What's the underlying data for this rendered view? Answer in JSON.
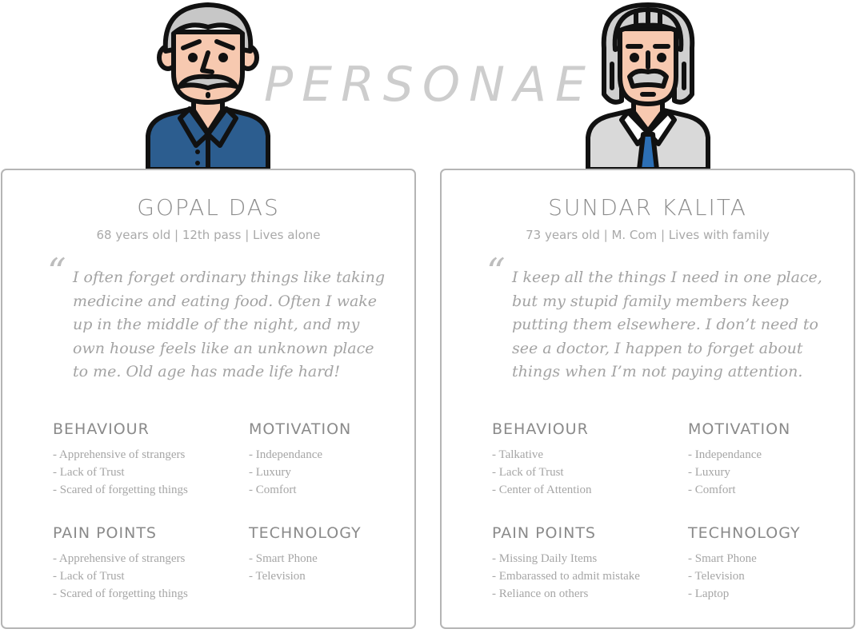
{
  "title": "PERSONAE",
  "personas": [
    {
      "name": "GOPAL DAS",
      "meta": "68 years old | 12th pass | Lives alone",
      "quote": "I often forget ordinary things like taking medicine and eating food. Often I wake up in the middle of the night, and my own house feels like an unknown place to me. Old age has made life hard!",
      "behaviour": {
        "title": "BEHAVIOUR",
        "items": [
          "- Apprehensive of strangers",
          "- Lack of Trust",
          "- Scared of forgetting things"
        ]
      },
      "motivation": {
        "title": "MOTIVATION",
        "items": [
          "- Independance",
          "- Luxury",
          "- Comfort"
        ]
      },
      "pain_points": {
        "title": "PAIN POINTS",
        "items": [
          "- Apprehensive of strangers",
          "- Lack of Trust",
          "- Scared of forgetting things"
        ]
      },
      "technology": {
        "title": "TECHNOLOGY",
        "items": [
          "- Smart Phone",
          "- Television"
        ]
      },
      "colors": {
        "shirt": "#2c5d8f",
        "hair": "#c7c7c7",
        "skin": "#f7c9b0"
      }
    },
    {
      "name": "SUNDAR KALITA",
      "meta": "73 years old | M. Com | Lives with family",
      "quote": "I keep all the things I need in one place, but my stupid family members keep putting them elsewhere. I don’t need to see a doctor, I happen to forget about things when I’m not paying attention.",
      "behaviour": {
        "title": "BEHAVIOUR",
        "items": [
          "- Talkative",
          "- Lack of Trust",
          "- Center of Attention"
        ]
      },
      "motivation": {
        "title": "MOTIVATION",
        "items": [
          "- Independance",
          "- Luxury",
          "- Comfort"
        ]
      },
      "pain_points": {
        "title": "PAIN POINTS",
        "items": [
          "- Missing Daily Items",
          "- Embarassed to admit mistake",
          "- Reliance on others"
        ]
      },
      "technology": {
        "title": "TECHNOLOGY",
        "items": [
          "- Smart Phone",
          "- Television",
          "- Laptop"
        ]
      },
      "colors": {
        "shirt": "#d9d9d9",
        "tie": "#2c6fb5",
        "hair": "#cfcfcf",
        "skin": "#f7c9b0"
      }
    }
  ]
}
